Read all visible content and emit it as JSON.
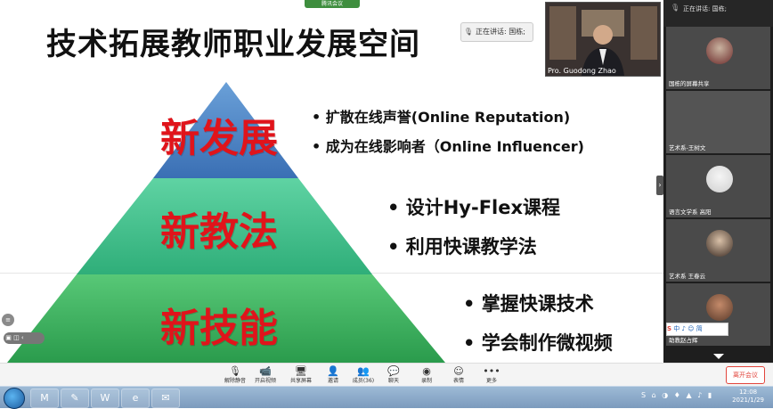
{
  "slide": {
    "title": "技术拓展教师职业发展空间",
    "levels": [
      {
        "label": "新发展",
        "bullets": [
          "• 扩散在线声誉(Online Reputation)",
          "• 成为在线影响者（Online Influencer)"
        ]
      },
      {
        "label": "新教法",
        "bullets": [
          "• 设计Hy-Flex课程",
          "• 利用快课教学法"
        ]
      },
      {
        "label": "新技能",
        "bullets": [
          "• 掌握快课技术",
          "• 学会制作微视频"
        ]
      }
    ]
  },
  "meeting": {
    "top_tab": "腾讯会议",
    "speaking_text": "正在讲话: 国栋;",
    "video_name": "Pro. Guodong Zhao",
    "panel": {
      "speaking_text": "正在讲话: 国栋;",
      "participants": [
        {
          "name": "国栋的屏幕共享"
        },
        {
          "name": "艺术系-王树文"
        },
        {
          "name": "语言文学系 高阳"
        },
        {
          "name": "艺术系 王春云"
        },
        {
          "name": "助教赵占辉"
        }
      ]
    },
    "toolbar": [
      {
        "label": "解除静音",
        "icon": "mic-muted-icon"
      },
      {
        "label": "开启视频",
        "icon": "camera-off-icon"
      },
      {
        "label": "共享屏幕",
        "icon": "share-screen-icon"
      },
      {
        "label": "邀请",
        "icon": "invite-icon"
      },
      {
        "label": "成员(36)",
        "icon": "members-icon"
      },
      {
        "label": "聊天",
        "icon": "chat-icon"
      },
      {
        "label": "录制",
        "icon": "record-icon"
      },
      {
        "label": "表情",
        "icon": "emoji-icon"
      },
      {
        "label": "更多",
        "icon": "more-icon"
      }
    ],
    "leave_label": "离开会议"
  },
  "taskbar": {
    "time": "12:08",
    "date": "2021/1/29",
    "ime": "中 ♪ ☺ 简"
  },
  "colors": {
    "level1": "#4a84c4",
    "level2": "#3cc08a",
    "level3": "#36b05b",
    "accent_red": "#e0141b",
    "leave": "#e2453c"
  }
}
